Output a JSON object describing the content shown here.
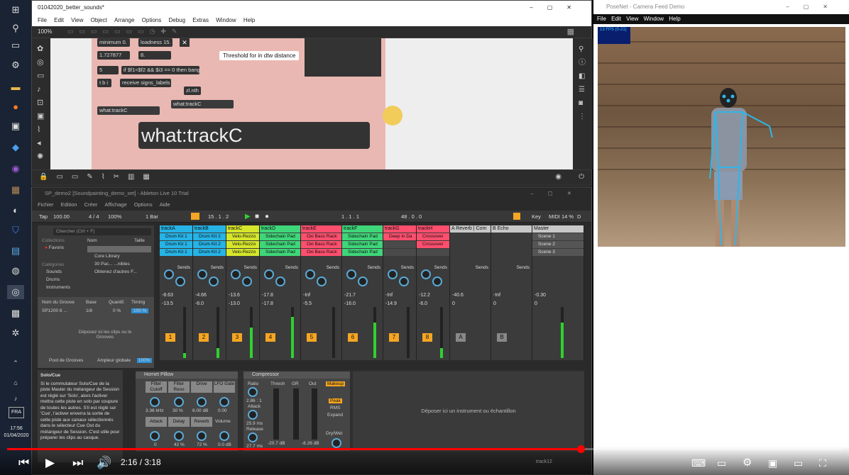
{
  "taskbar": {
    "clock_time": "17:56",
    "clock_date": "01/04/2020",
    "lang": "FRA"
  },
  "max": {
    "title": "01042020_better_sounds*",
    "menu": [
      "File",
      "Edit",
      "View",
      "Object",
      "Arrange",
      "Options",
      "Debug",
      "Extras",
      "Window",
      "Help"
    ],
    "zoom": "100%",
    "objects": [
      "minimum 0.",
      "loadness 15.",
      "1.727877",
      "8.",
      "5",
      "if $f1<$f2 && $i3 == 0 then bang",
      "t b i",
      "receive signs_labels",
      "zl.nth",
      "what:trackC",
      "what:trackC"
    ],
    "tooltip": "Threshold for in dtw distance",
    "big_message": "what:trackC"
  },
  "ableton": {
    "title": "SP_demo2  [Soundpainting_demo_set] - Ableton Live 10 Trial",
    "menu": [
      "Fichier",
      "Edition",
      "Créer",
      "Affichage",
      "Options",
      "Aide"
    ],
    "transport": {
      "tap": "Tap",
      "tempo": "100.00",
      "sig": "4 / 4",
      "zoom": "100%",
      "bar": "1 Bar",
      "pos": "15 . 1 . 2",
      "loop": "1 . 1 . 1",
      "len": "48 . 0 . 0",
      "key": "Key",
      "midi": "MIDI",
      "cpu": "14 %",
      "d": "D"
    },
    "browser": {
      "search": "Chercher (Ctrl + F)",
      "collections_label": "Collections",
      "favoris": "Favoris",
      "categories_label": "Catégories",
      "cats": [
        "Sounds",
        "Drums",
        "Instruments"
      ],
      "name_col": "Nom",
      "size_col": "Taille",
      "entries": [
        "Core Library",
        "30 Pac... ...nibles",
        "Obtenez d'autres F..."
      ]
    },
    "groove": {
      "h1": "Nom du Groove",
      "h2": "Base",
      "h3": "Quantif.",
      "h4": "Timing",
      "row_name": "SP1200 8 ...",
      "row_base": "1/8",
      "row_q": "0 %",
      "row_t": "100 %",
      "drop": "Déposez ici les clips ou le Grooves",
      "pool": "Pool de Grooves",
      "amp_label": "Ampleur globale",
      "amp": "100%"
    },
    "tracks": [
      {
        "name": "trackA",
        "color": "#26b3e6",
        "clips": [
          "Drum Kit 1",
          "Drum Kit 1",
          "Drum Kit 1"
        ],
        "vol": "-8.63",
        "sub": "-13.5",
        "num": "1"
      },
      {
        "name": "trackB",
        "color": "#26b3e6",
        "clips": [
          "Drum Kit 2",
          "Drum Kit 2",
          "Drum Kit 2"
        ],
        "vol": "-4.66",
        "sub": "-6.0",
        "num": "2"
      },
      {
        "name": "trackC",
        "color": "#d6e62b",
        "clips": [
          "Velo-Rezzo",
          "Velo-Rezzo",
          "Velo-Rezzo"
        ],
        "vol": "-13.6",
        "sub": "-13.0",
        "num": "3"
      },
      {
        "name": "trackD",
        "color": "#3fd67a",
        "clips": [
          "Sidechain Pad",
          "Sidechain Pad",
          "Sidechain Pad"
        ],
        "vol": "-17.8",
        "sub": "-17.8",
        "num": "4"
      },
      {
        "name": "trackE",
        "color": "#ff4f6e",
        "clips": [
          "Oxi Bass Rack",
          "Oxi Bass Rack",
          "Oxi Bass Rack"
        ],
        "vol": "-Inf",
        "sub": "-5.5",
        "num": "5"
      },
      {
        "name": "trackF",
        "color": "#3fd67a",
        "clips": [
          "Sidechain Pad",
          "Sidechain Pad",
          "Sidechain Pad"
        ],
        "vol": "-21.7",
        "sub": "-16.0",
        "num": "6"
      },
      {
        "name": "trackG",
        "color": "#ff4f6e",
        "clips": [
          "Deep in Da",
          "",
          ""
        ],
        "vol": "-Inf",
        "sub": "-14.9",
        "num": "7"
      },
      {
        "name": "trackH",
        "color": "#ff4f6e",
        "clips": [
          "Crossover",
          "Crossover",
          ""
        ],
        "vol": "-12.2",
        "sub": "-6.0",
        "num": "8"
      }
    ],
    "returns": [
      {
        "name": "A Reverb | Com",
        "vol": "-40.6",
        "sub": "0",
        "num": "A"
      },
      {
        "name": "B Echo",
        "vol": "-Inf",
        "sub": "0",
        "num": "B"
      }
    ],
    "master": {
      "name": "Master",
      "scenes": [
        "Scene 1",
        "Scene 2",
        "Scene 3"
      ],
      "vol": "-0.30",
      "sub": "0"
    },
    "sends_label": "Sends",
    "info": {
      "title": "Solo/Cue",
      "text": "Si le commutateur Solo/Cue de la piste Master du mélangeur de Session est réglé sur 'Solo', alors l'activer mettra cette piste en solo par coupure de toutes les autres. S'il est réglé sur 'Cue', l'activer enverra la sortie de cette piste aux canaux sélectionnés dans le sélecteur Cue Out du mélangeur de Session. C'est utile pour préparer les clips au casque."
    },
    "filter_dev": {
      "name": "Hornet Pillow",
      "params": [
        "Filter Cutoff",
        "Filter Reso",
        "Drive",
        "LFO Gate",
        "Attack",
        "Delay",
        "Reverb",
        "Volume"
      ],
      "vals": [
        "3.36 kHz",
        "30 %",
        "6.00 dB",
        "0.00",
        "0",
        "42 %",
        "72 %",
        "0.0 dB"
      ]
    },
    "comp_dev": {
      "name": "Compressor",
      "ratio_label": "Ratio",
      "ratio": "2.86 : 1",
      "attack_label": "Attack",
      "attack": "25.9 ms",
      "release_label": "Release",
      "release": "27.7 ms",
      "thresh": "Thresh",
      "gr": "GR",
      "out": "Out",
      "makeup": "Makeup",
      "peak": "Peak",
      "rms": "RMS",
      "expand": "Expand",
      "drywet": "Dry/Wet",
      "t_val": "-20.7 dB",
      "o_val": "-8.26 dB"
    },
    "drop_instr": "Déposer ici un instrument ou échantillon",
    "status": "track12"
  },
  "posenet": {
    "title": "PoseNet - Camera Feed Demo",
    "menu": [
      "File",
      "Edit",
      "View",
      "Window",
      "Help"
    ],
    "fps": "13 FPS (0-21)"
  },
  "player": {
    "current": "2:16",
    "duration": "3:18",
    "separator": " / ",
    "progress": 0.687
  }
}
